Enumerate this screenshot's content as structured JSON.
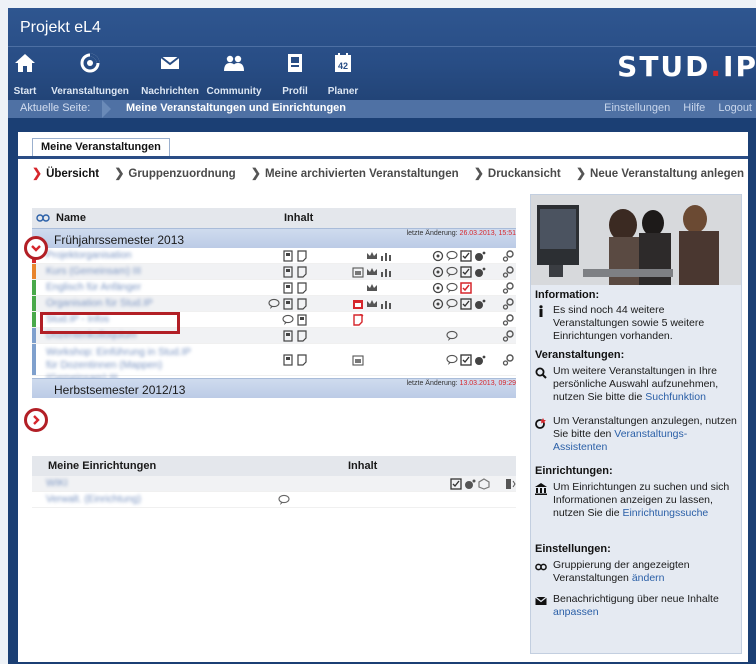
{
  "app": {
    "project_title": "Projekt eL4",
    "logo_left": "STUD",
    "logo_dot": ".",
    "logo_right": "IP"
  },
  "nav": [
    {
      "label": "Start",
      "icon": "home-icon"
    },
    {
      "label": "Veranstaltungen",
      "icon": "courses-icon"
    },
    {
      "label": "Nachrichten",
      "icon": "mail-icon"
    },
    {
      "label": "Community",
      "icon": "community-icon"
    },
    {
      "label": "Profil",
      "icon": "profile-icon"
    },
    {
      "label": "Planer",
      "icon": "calendar-icon",
      "badge": "42"
    }
  ],
  "breadcrumb": {
    "label": "Aktuelle Seite:",
    "page": "Meine Veranstaltungen und Einrichtungen"
  },
  "header_links": {
    "settings": "Einstellungen",
    "help": "Hilfe",
    "logout": "Logout"
  },
  "tab": {
    "label": "Meine Veranstaltungen"
  },
  "subnav": [
    "Übersicht",
    "Gruppenzuordnung",
    "Meine archivierten Veranstaltungen",
    "Druckansicht",
    "Neue Veranstaltung anlegen"
  ],
  "courses_table": {
    "col_name": "Name",
    "col_content": "Inhalt",
    "semesters": [
      {
        "name": "Frühjahrssemester 2013",
        "changed_label": "letzte Änderung:",
        "changed_date": "26.03.2013, 15:51",
        "expanded": true,
        "rows": [
          {
            "name": "Projektorganisation",
            "color": "#d6262c"
          },
          {
            "name": "Kurs (Gemeinsam) III",
            "color": "#e8842c"
          },
          {
            "name": "Englisch für Anfänger",
            "color": "#49a94a"
          },
          {
            "name": "Organisation für Stud.IP",
            "color": "#49a94a"
          },
          {
            "name": "Stud.IP - Infos",
            "color": "#49a94a"
          },
          {
            "name": "Dozentenkolloquium",
            "color": "#7fa0cd"
          },
          {
            "name": "Workshop: Einführung in Stud.IP für Dozentinnen (Mappen) (Gemeinsam) III",
            "color": "#7fa0cd"
          }
        ]
      },
      {
        "name": "Herbstsemester 2012/13",
        "changed_label": "letzte Änderung:",
        "changed_date": "13.03.2013, 09:29",
        "expanded": false
      }
    ]
  },
  "institutes_table": {
    "col_name": "Meine Einrichtungen",
    "col_content": "Inhalt",
    "rows": [
      {
        "name": "WIKI"
      },
      {
        "name": "Verwalt. (Einrichtung)"
      }
    ]
  },
  "sidebar": {
    "info_title": "Information:",
    "info_text": "Es sind noch 44 weitere Veranstaltungen sowie 5 weitere Einrichtungen vorhanden.",
    "courses_title": "Veranstaltungen:",
    "search_text": "Um weitere Veranstaltungen in Ihre persönliche Auswahl aufzunehmen, nutzen Sie bitte die ",
    "search_link": "Suchfunktion",
    "create_text": "Um Veranstaltungen anzulegen, nutzen Sie bitte den ",
    "create_link": "Veranstaltungs-Assistenten",
    "institutes_title": "Einrichtungen:",
    "inst_text": "Um Einrichtungen zu suchen und sich Informationen anzeigen zu lassen, nutzen Sie die ",
    "inst_link": "Einrichtungssuche",
    "settings_title": "Einstellungen:",
    "group_text": "Gruppierung der angezeigten Veranstaltungen ",
    "group_link": "ändern",
    "notify_text": "Benachrichtigung über neue Inhalte ",
    "notify_link": "anpassen"
  }
}
